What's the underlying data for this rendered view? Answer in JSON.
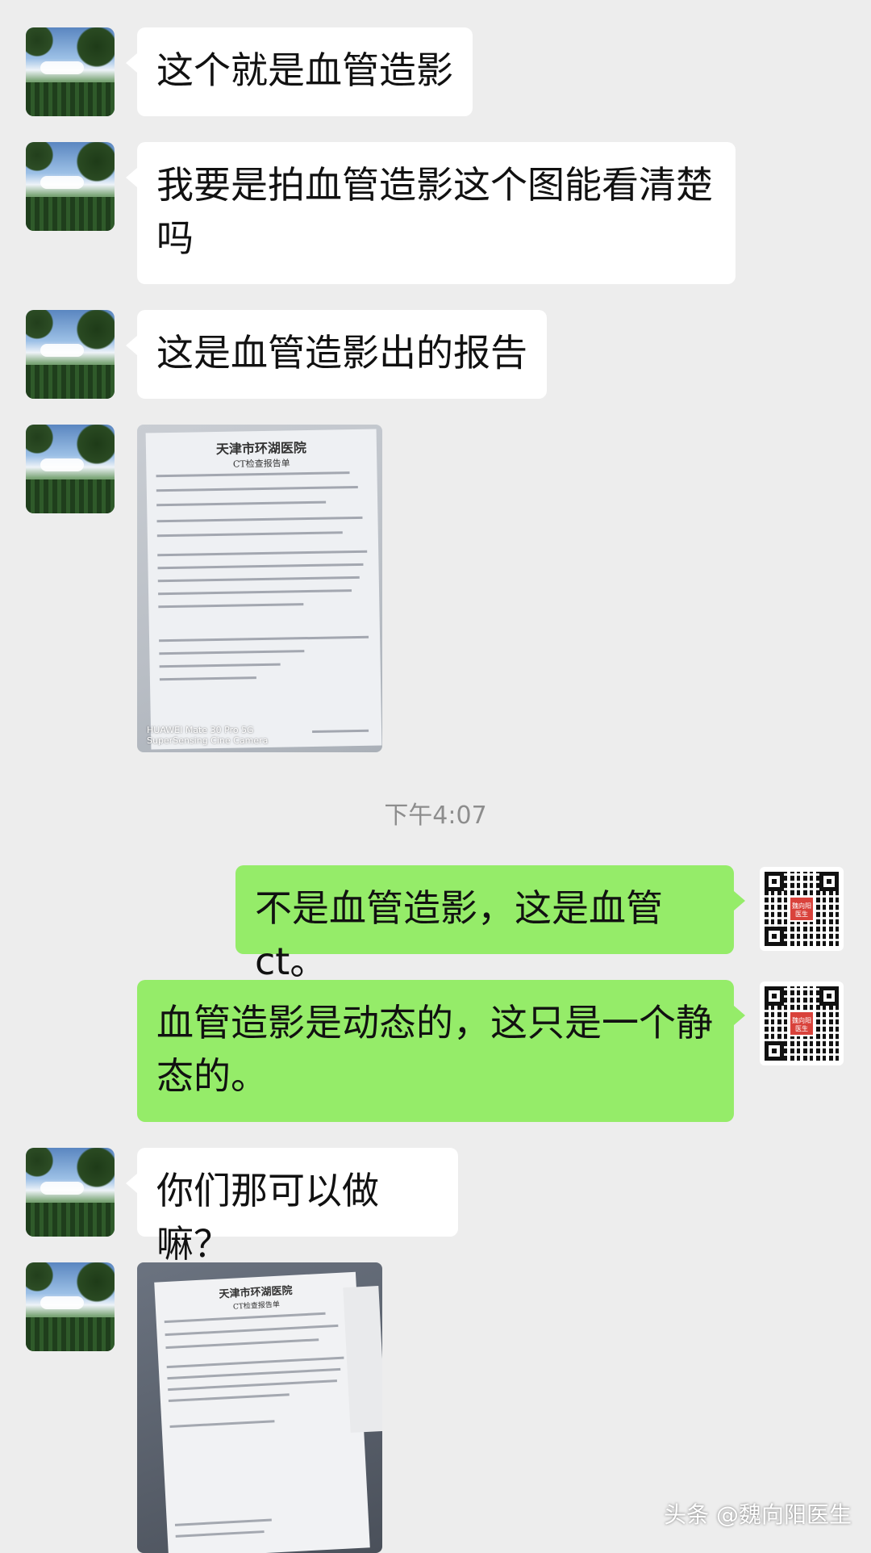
{
  "messages": [
    {
      "side": "left",
      "type": "text",
      "text": "这个就是血管造影"
    },
    {
      "side": "left",
      "type": "text",
      "text": "我要是拍血管造影这个图能看清楚吗"
    },
    {
      "side": "left",
      "type": "text",
      "text": "这是血管造影出的报告"
    },
    {
      "side": "left",
      "type": "image",
      "doc_title": "天津市环湖医院",
      "doc_subtitle": "CT检查报告单",
      "caption": "HUAWEI Mate 30 Pro 5G\nSuperSensing Cine Camera"
    },
    {
      "side": "right",
      "type": "text",
      "text": "不是血管造影，这是血管 ct。"
    },
    {
      "side": "right",
      "type": "text",
      "text": "血管造影是动态的，这只是一个静态的。"
    },
    {
      "side": "left",
      "type": "text",
      "text": "你们那可以做嘛？"
    },
    {
      "side": "left",
      "type": "image",
      "doc_title": "天津市环湖医院",
      "doc_subtitle": "CT检查报告单"
    }
  ],
  "timestamp": "下午4:07",
  "watermark": "头条 @魏向阳医生",
  "qr_center_label": "魏向阳医生",
  "colors": {
    "background": "#ededed",
    "incoming_bubble": "#ffffff",
    "outgoing_bubble": "#95ec69"
  }
}
